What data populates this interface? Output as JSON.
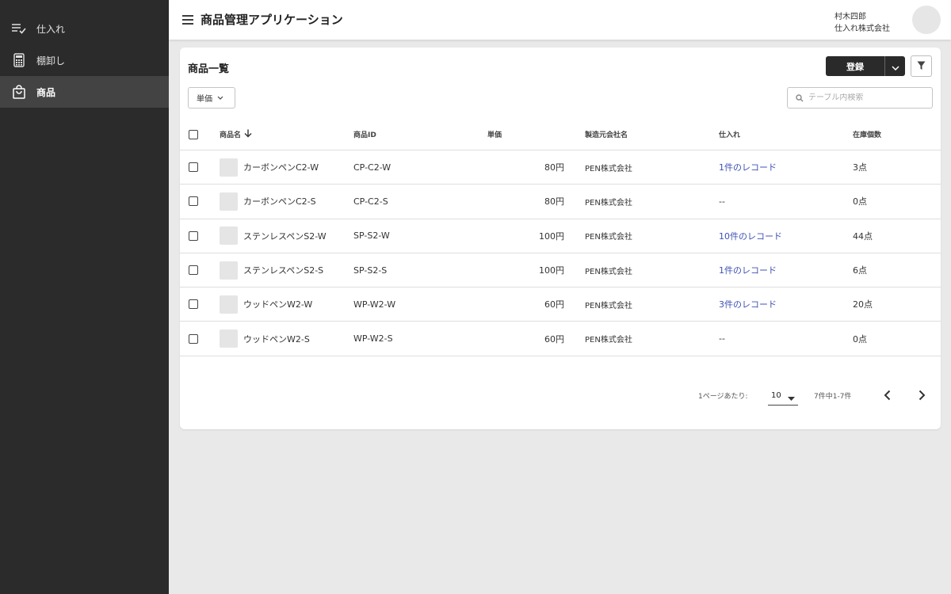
{
  "app": {
    "title": "商品管理アプリケーション"
  },
  "user": {
    "name": "村木四郎",
    "company": "仕入れ株式会社"
  },
  "sidebar": {
    "items": [
      {
        "label": "仕入れ",
        "icon": "playlist-check-icon",
        "active": false
      },
      {
        "label": "棚卸し",
        "icon": "calculator-icon",
        "active": false
      },
      {
        "label": "商品",
        "icon": "shopping-bag-icon",
        "active": true
      }
    ]
  },
  "card": {
    "title": "商品一覧",
    "register_label": "登録",
    "filter_chip_label": "単価",
    "search_placeholder": "テーブル内検索"
  },
  "table": {
    "headers": {
      "name": "商品名",
      "id": "商品ID",
      "price": "単価",
      "maker": "製造元会社名",
      "stock": "仕入れ",
      "count": "在庫個数"
    },
    "rows": [
      {
        "name": "カーボンペンC2-W",
        "id": "CP-C2-W",
        "price": "80円",
        "maker": "PEN株式会社",
        "stock": "1件のレコード",
        "stock_link": true,
        "count": "3点"
      },
      {
        "name": "カーボンペンC2-S",
        "id": "CP-C2-S",
        "price": "80円",
        "maker": "PEN株式会社",
        "stock": "--",
        "stock_link": false,
        "count": "0点"
      },
      {
        "name": "ステンレスペンS2-W",
        "id": "SP-S2-W",
        "price": "100円",
        "maker": "PEN株式会社",
        "stock": "10件のレコード",
        "stock_link": true,
        "count": "44点"
      },
      {
        "name": "ステンレスペンS2-S",
        "id": "SP-S2-S",
        "price": "100円",
        "maker": "PEN株式会社",
        "stock": "1件のレコード",
        "stock_link": true,
        "count": "6点"
      },
      {
        "name": "ウッドペンW2-W",
        "id": "WP-W2-W",
        "price": "60円",
        "maker": "PEN株式会社",
        "stock": "3件のレコード",
        "stock_link": true,
        "count": "20点"
      },
      {
        "name": "ウッドペンW2-S",
        "id": "WP-W2-S",
        "price": "60円",
        "maker": "PEN株式会社",
        "stock": "--",
        "stock_link": false,
        "count": "0点"
      }
    ]
  },
  "pagination": {
    "per_page_label": "1ページあたり:",
    "per_page_value": "10",
    "range_label": "7件中1-7件"
  },
  "colors": {
    "sidebar_bg": "#2b2b2b",
    "sidebar_active": "#434343",
    "link": "#3f51b5",
    "primary_button": "#2a2a2a"
  }
}
